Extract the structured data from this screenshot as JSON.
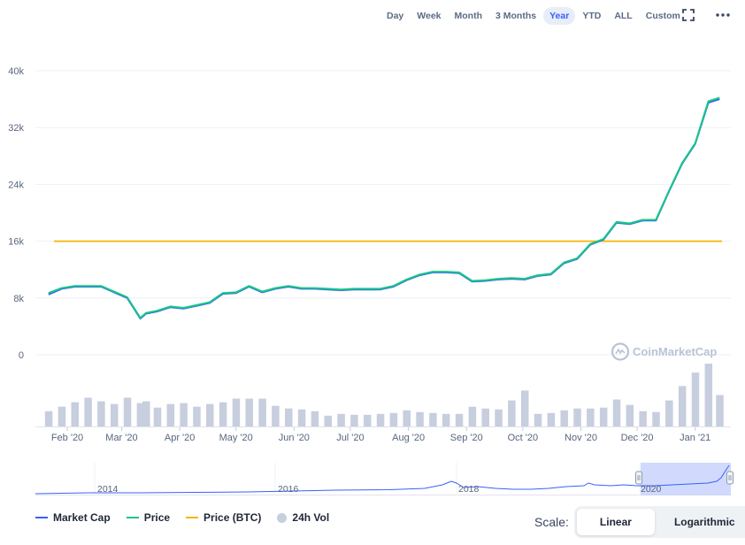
{
  "range_buttons": [
    {
      "label": "Day",
      "active": false
    },
    {
      "label": "Week",
      "active": false
    },
    {
      "label": "Month",
      "active": false
    },
    {
      "label": "3 Months",
      "active": false
    },
    {
      "label": "Year",
      "active": true
    },
    {
      "label": "YTD",
      "active": false
    },
    {
      "label": "ALL",
      "active": false
    },
    {
      "label": "Custom",
      "active": false
    }
  ],
  "icons": {
    "fullscreen": "fullscreen-icon",
    "more": "more-horizontal-icon"
  },
  "watermark": "CoinMarketCap",
  "legend": [
    {
      "label": "Market Cap",
      "color": "#3861fb",
      "kind": "line"
    },
    {
      "label": "Price",
      "color": "#16c784",
      "kind": "line"
    },
    {
      "label": "Price (BTC)",
      "color": "#f7b500",
      "kind": "line"
    },
    {
      "label": "24h Vol",
      "color": "#c7cede",
      "kind": "dot"
    }
  ],
  "scale": {
    "label": "Scale:",
    "options": [
      {
        "label": "Linear",
        "active": true
      },
      {
        "label": "Logarithmic",
        "active": false
      }
    ]
  },
  "navigator": {
    "year_labels": [
      "2014",
      "2016",
      "2018",
      "2020"
    ]
  },
  "chart_data": {
    "type": "line",
    "x_ticks": [
      "Feb '20",
      "Mar '20",
      "Apr '20",
      "May '20",
      "Jun '20",
      "Jul '20",
      "Aug '20",
      "Sep '20",
      "Oct '20",
      "Nov '20",
      "Dec '20",
      "Jan '21"
    ],
    "y_ticks": [
      "0",
      "8k",
      "16k",
      "24k",
      "32k",
      "40k"
    ],
    "ylim": [
      0,
      40000
    ],
    "grid": true,
    "legend_placement": "bottom-left",
    "x": [
      "2020-01-22",
      "2020-01-29",
      "2020-02-05",
      "2020-02-12",
      "2020-02-19",
      "2020-02-26",
      "2020-03-04",
      "2020-03-11",
      "2020-03-14",
      "2020-03-20",
      "2020-03-27",
      "2020-04-03",
      "2020-04-10",
      "2020-04-17",
      "2020-04-24",
      "2020-05-01",
      "2020-05-08",
      "2020-05-15",
      "2020-05-22",
      "2020-05-29",
      "2020-06-05",
      "2020-06-12",
      "2020-06-19",
      "2020-06-26",
      "2020-07-03",
      "2020-07-10",
      "2020-07-17",
      "2020-07-24",
      "2020-07-31",
      "2020-08-07",
      "2020-08-14",
      "2020-08-21",
      "2020-08-28",
      "2020-09-04",
      "2020-09-11",
      "2020-09-18",
      "2020-09-25",
      "2020-10-02",
      "2020-10-09",
      "2020-10-16",
      "2020-10-23",
      "2020-10-30",
      "2020-11-06",
      "2020-11-13",
      "2020-11-20",
      "2020-11-27",
      "2020-12-04",
      "2020-12-11",
      "2020-12-18",
      "2020-12-25",
      "2021-01-01",
      "2021-01-08",
      "2021-01-14"
    ],
    "series": [
      {
        "name": "Market Cap",
        "color": "#3861fb",
        "values": [
          8500,
          9300,
          9600,
          9600,
          9600,
          8800,
          8000,
          5100,
          5800,
          6100,
          6700,
          6500,
          6900,
          7300,
          8600,
          8700,
          9600,
          8800,
          9300,
          9600,
          9300,
          9300,
          9200,
          9100,
          9200,
          9200,
          9200,
          9600,
          10500,
          11200,
          11600,
          11600,
          11500,
          10300,
          10400,
          10600,
          10700,
          10600,
          11100,
          11300,
          12900,
          13500,
          15500,
          16200,
          18600,
          18400,
          18900,
          18900,
          23000,
          26900,
          29700,
          35500,
          36000
        ]
      },
      {
        "name": "Price",
        "color": "#16c784",
        "values": [
          8700,
          9400,
          9700,
          9700,
          9700,
          8900,
          8100,
          5200,
          5900,
          6200,
          6800,
          6600,
          7000,
          7400,
          8700,
          8800,
          9700,
          8900,
          9400,
          9700,
          9400,
          9400,
          9300,
          9200,
          9300,
          9300,
          9300,
          9700,
          10600,
          11300,
          11700,
          11700,
          11600,
          10400,
          10500,
          10700,
          10800,
          10700,
          11200,
          11400,
          13000,
          13600,
          15600,
          16300,
          18700,
          18500,
          19000,
          19000,
          23100,
          27000,
          29800,
          35700,
          36200
        ]
      },
      {
        "name": "Price (BTC)",
        "color": "#f7b500",
        "values": [
          16000,
          16000
        ]
      },
      {
        "name": "24h Vol",
        "color": "#c7cede",
        "values": [
          17,
          22,
          27,
          32,
          28,
          25,
          32,
          26,
          28,
          21,
          25,
          26,
          22,
          25,
          27,
          31,
          31,
          31,
          23,
          20,
          19,
          17,
          12,
          14,
          13,
          13,
          14,
          15,
          18,
          16,
          15,
          14,
          14,
          22,
          20,
          19,
          29,
          40,
          14,
          15,
          18,
          20,
          20,
          21,
          30,
          24,
          17,
          16,
          29,
          45,
          60,
          70,
          35
        ]
      }
    ]
  }
}
